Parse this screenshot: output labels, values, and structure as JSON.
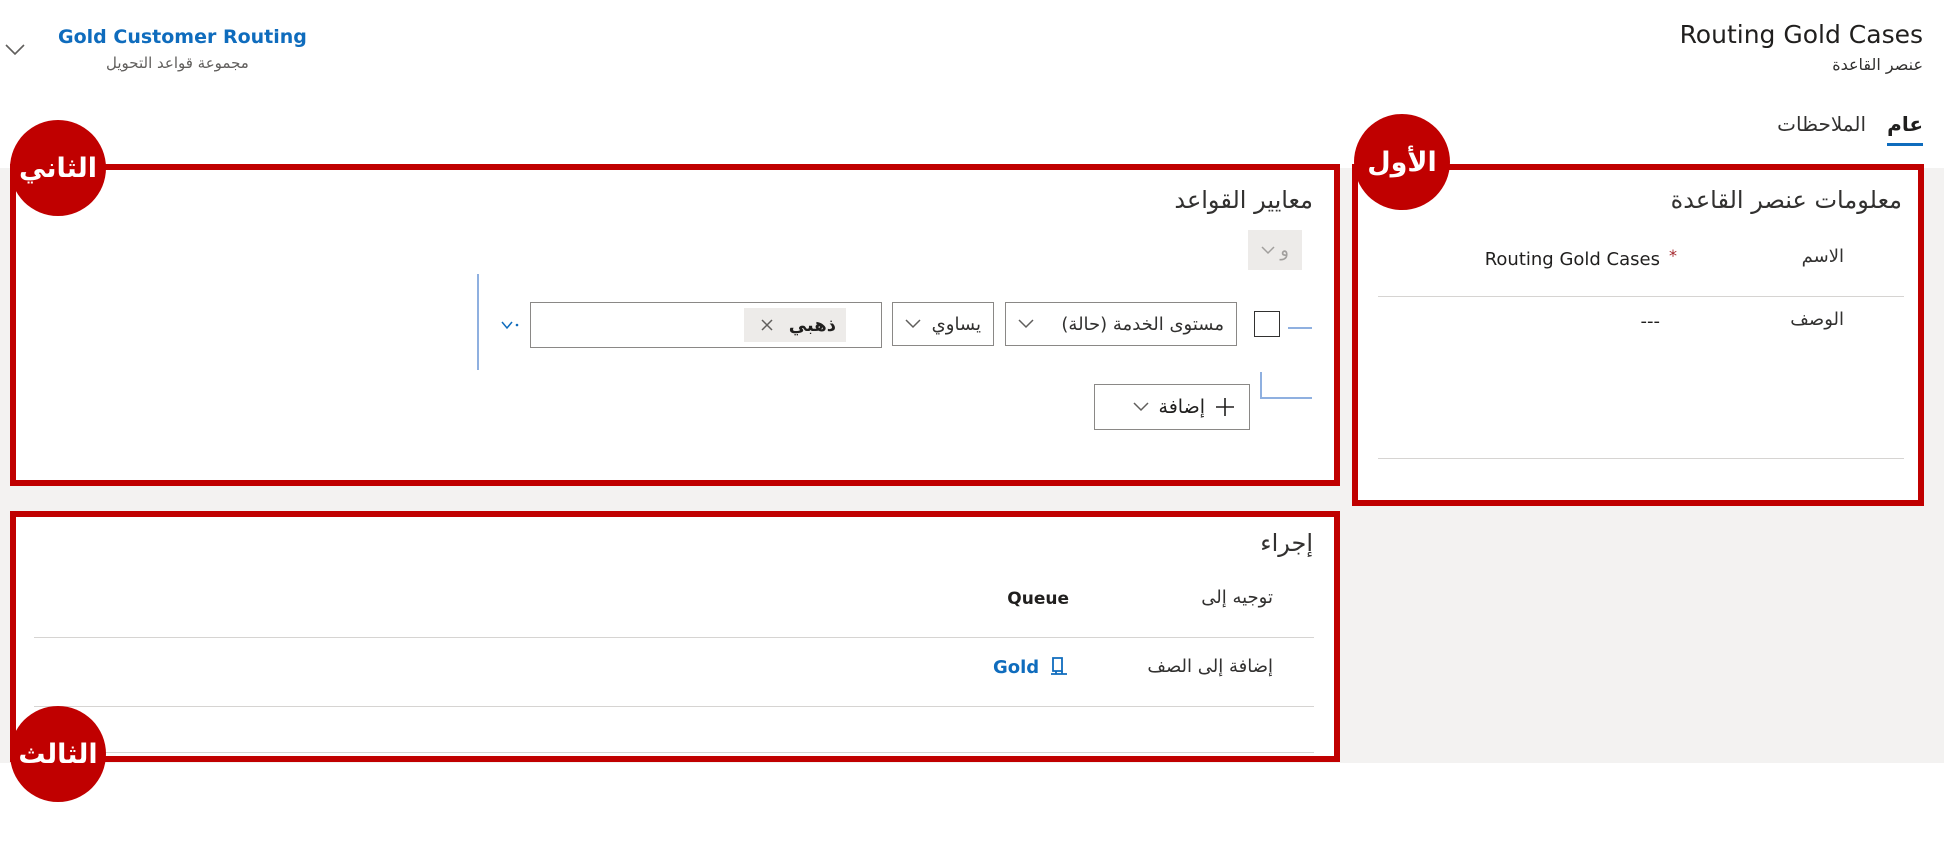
{
  "header": {
    "title": "Routing Gold Cases",
    "subtitle": "عنصر القاعدة",
    "context_link": "Gold Customer Routing",
    "context_sub": "مجموعة قواعد التحويل"
  },
  "tabs": [
    {
      "label": "عام",
      "selected": true
    },
    {
      "label": "الملاحظات",
      "selected": false
    }
  ],
  "rule_info": {
    "title": "معلومات عنصر القاعدة",
    "name_label": "الاسم",
    "name_value": "Routing Gold Cases",
    "required_mark": "*",
    "description_label": "الوصف",
    "description_value": "---"
  },
  "criteria": {
    "title": "معايير القواعد",
    "group_operator": "و",
    "condition": {
      "field": "مستوى الخدمة (حالة)",
      "operator": "يساوي",
      "value_tag": "ذهبي"
    },
    "add_button": "إضافة"
  },
  "action": {
    "title": "إجراء",
    "route_to_label": "توجيه إلى",
    "route_to_value": "Queue",
    "add_to_queue_label": "إضافة إلى الصف",
    "add_to_queue_value": "Gold"
  },
  "annotations": {
    "first": "الأول",
    "second": "الثاني",
    "third": "الثالث"
  },
  "colors": {
    "annotation_red": "#c00000",
    "link_blue": "#0f6cbd",
    "workarea_grey": "#f3f2f1"
  }
}
